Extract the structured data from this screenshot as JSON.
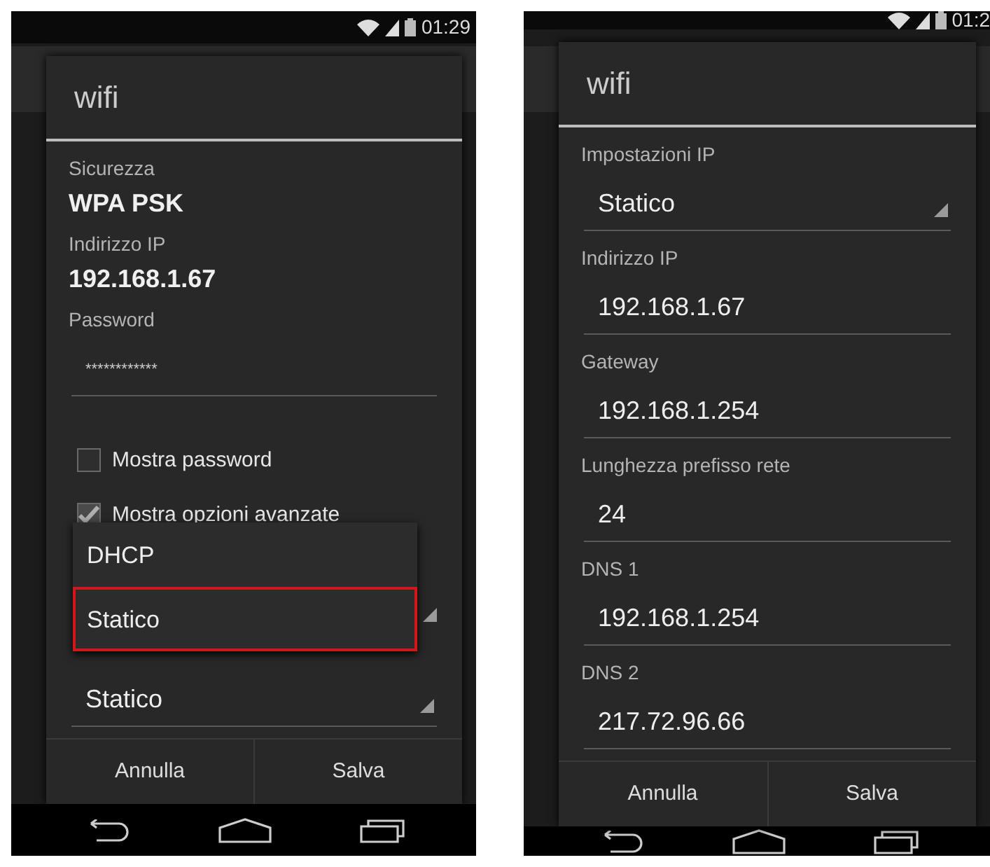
{
  "screens": [
    {
      "status_bar": {
        "time": "01:29"
      },
      "dialog": {
        "title": "wifi",
        "items": [
          {
            "kind": "info",
            "label": "Sicurezza",
            "value": "WPA PSK"
          },
          {
            "kind": "info",
            "label": "Indirizzo IP",
            "value": "192.168.1.67"
          },
          {
            "kind": "password",
            "label": "Password",
            "value": "************"
          },
          {
            "kind": "checkbox",
            "label": "Mostra password",
            "checked": false
          },
          {
            "kind": "checkbox",
            "label": "Mostra opzioni avanzate",
            "checked": true
          },
          {
            "kind": "covered_spinner"
          },
          {
            "kind": "spinner",
            "value": "Statico"
          }
        ],
        "popup": {
          "options": [
            {
              "label": "DHCP",
              "selected": false
            },
            {
              "label": "Statico",
              "selected": true
            }
          ]
        },
        "buttons": [
          "Annulla",
          "Salva"
        ]
      }
    },
    {
      "status_bar": {
        "time": "01:2"
      },
      "dialog": {
        "title": "wifi",
        "items": [
          {
            "kind": "spinner",
            "label": "Impostazioni IP",
            "value": "Statico"
          },
          {
            "kind": "field",
            "label": "Indirizzo IP",
            "value": "192.168.1.67"
          },
          {
            "kind": "field",
            "label": "Gateway",
            "value": "192.168.1.254"
          },
          {
            "kind": "field",
            "label": "Lunghezza prefisso rete",
            "value": "24"
          },
          {
            "kind": "field",
            "label": "DNS 1",
            "value": "192.168.1.254"
          },
          {
            "kind": "field",
            "label": "DNS 2",
            "value": "217.72.96.66"
          }
        ],
        "buttons": [
          "Annulla",
          "Salva"
        ]
      }
    }
  ]
}
